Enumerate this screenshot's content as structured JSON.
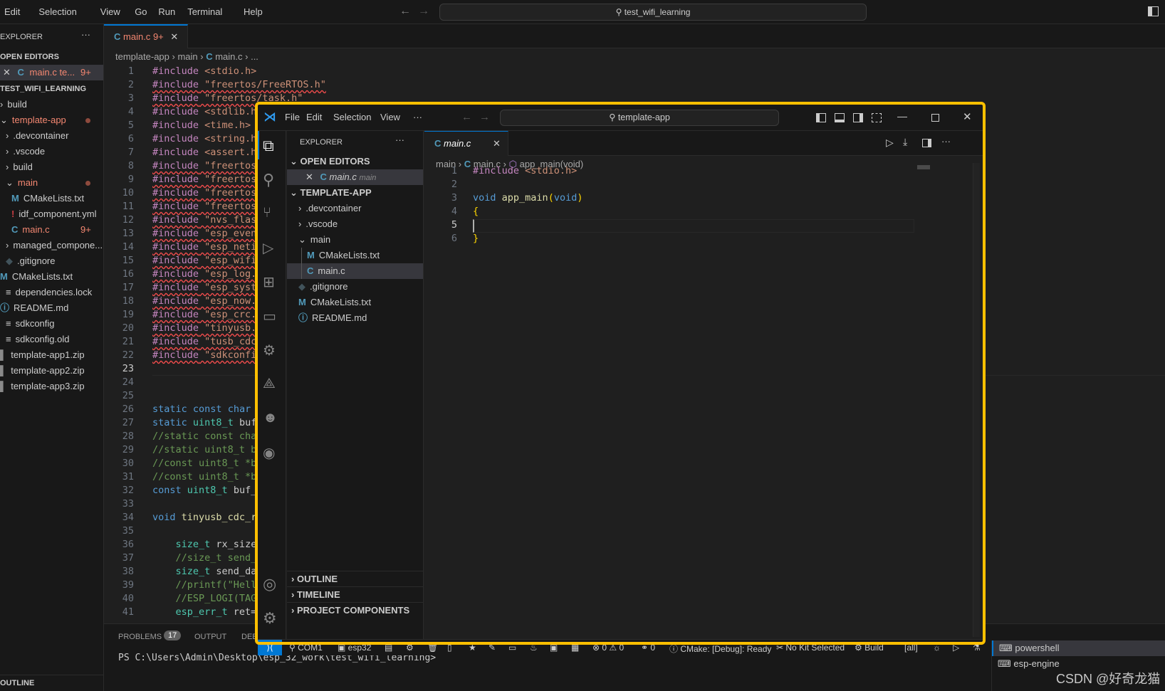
{
  "outer": {
    "menu": [
      "Edit",
      "Selection",
      "View",
      "Go",
      "Run",
      "Terminal",
      "Help"
    ],
    "search": "test_wifi_learning",
    "explorer_title": "EXPLORER",
    "more": "···",
    "open_editors_label": "OPEN EDITORS",
    "open_editor": {
      "name": "main.c te...",
      "badge": "9+"
    },
    "workspace_label": "TEST_WIFI_LEARNING",
    "tree": [
      {
        "name": "build",
        "indent": 0,
        "kind": "folder",
        "chev": ">"
      },
      {
        "name": "template-app",
        "indent": 0,
        "kind": "folder",
        "chev": "v",
        "color": "#f48771",
        "dot": true
      },
      {
        "name": ".devcontainer",
        "indent": 1,
        "kind": "folder",
        "chev": ">"
      },
      {
        "name": ".vscode",
        "indent": 1,
        "kind": "folder",
        "chev": ">"
      },
      {
        "name": "build",
        "indent": 1,
        "kind": "folder",
        "chev": ">"
      },
      {
        "name": "main",
        "indent": 1,
        "kind": "folder",
        "chev": "v",
        "color": "#f48771",
        "dot": true
      },
      {
        "name": "CMakeLists.txt",
        "indent": 2,
        "icon": "M",
        "iconColor": "#519aba"
      },
      {
        "name": "idf_component.yml",
        "indent": 2,
        "icon": "!",
        "iconColor": "#cc3e44"
      },
      {
        "name": "main.c",
        "indent": 2,
        "icon": "C",
        "iconColor": "#519aba",
        "color": "#f48771",
        "badge": "9+"
      },
      {
        "name": "managed_compone...",
        "indent": 1,
        "kind": "folder",
        "chev": ">"
      },
      {
        "name": ".gitignore",
        "indent": 1,
        "icon": "◆",
        "iconColor": "#41535b"
      },
      {
        "name": "CMakeLists.txt",
        "indent": 0,
        "icon": "M",
        "iconColor": "#519aba"
      },
      {
        "name": "dependencies.lock",
        "indent": 1,
        "icon": "≡",
        "iconColor": "#cccccc"
      },
      {
        "name": "README.md",
        "indent": 0,
        "icon": "ⓘ",
        "iconColor": "#519aba"
      },
      {
        "name": "sdkconfig",
        "indent": 1,
        "icon": "≡",
        "iconColor": "#cccccc"
      },
      {
        "name": "sdkconfig.old",
        "indent": 1,
        "icon": "≡",
        "iconColor": "#cccccc"
      },
      {
        "name": "template-app1.zip",
        "indent": 0,
        "icon": "▌",
        "iconColor": "#8a8a8a"
      },
      {
        "name": "template-app2.zip",
        "indent": 0,
        "icon": "▌",
        "iconColor": "#8a8a8a"
      },
      {
        "name": "template-app3.zip",
        "indent": 0,
        "icon": "▌",
        "iconColor": "#8a8a8a"
      }
    ],
    "outline_label": "OUTLINE",
    "tab": {
      "name": "main.c",
      "badge": "9+"
    },
    "breadcrumb": [
      "template-app",
      "main",
      "main.c",
      "..."
    ],
    "current_line": 23,
    "squiggle_lines": [
      2,
      3,
      8,
      9,
      10,
      11,
      12,
      13,
      14,
      15,
      16,
      17,
      18,
      19,
      20,
      21,
      22
    ],
    "code": [
      "#include <stdio.h>",
      "#include \"freertos/FreeRTOS.h\"",
      "#include \"freertos/task.h\"",
      "#include <stdlib.h>",
      "#include <time.h>",
      "#include <string.h>",
      "#include <assert.h>",
      "#include \"freertos/",
      "#include \"freertos/",
      "#include \"freertos/",
      "#include \"freertos/",
      "#include \"nvs_flash",
      "#include \"esp_event",
      "#include \"esp_netif",
      "#include \"esp_wifi.",
      "#include \"esp_log.h",
      "#include \"esp_syste",
      "#include \"esp_now.h",
      "#include \"esp_crc.h",
      "#include \"tinyusb.h",
      "#include \"tusb_cdc_",
      "#include \"sdkconfig",
      "",
      "",
      "",
      "static const char *",
      "static uint8_t buf[",
      "//static const char",
      "//static uint8_t bu",
      "//const uint8_t *bu",
      "//const uint8_t *bu",
      "const uint8_t buf_s",
      "",
      "void tinyusb_cdc_rx",
      "",
      "    size_t rx_size=",
      "    //size_t send_d",
      "    size_t send_dat",
      "    //printf(\"Hello",
      "    //ESP_LOGI(TAG,",
      "    esp_err_t ret=t"
    ],
    "panel_tabs": [
      "PROBLEMS",
      "OUTPUT",
      "DEE"
    ],
    "problems_count": "17",
    "terminal_prompt": "PS C:\\Users\\Admin\\Desktop\\esp_32_work\\test_wifi_learning>",
    "terminals": [
      "powershell",
      "esp-engine"
    ],
    "watermark": "CSDN @好奇龙猫"
  },
  "inner": {
    "menu": [
      "File",
      "Edit",
      "Selection",
      "View",
      "···"
    ],
    "search": "template-app",
    "explorer_title": "EXPLORER",
    "more": "···",
    "open_editors_label": "OPEN EDITORS",
    "open_editor": {
      "name": "main.c",
      "folder": "main"
    },
    "workspace_label": "TEMPLATE-APP",
    "tree": [
      {
        "name": ".devcontainer",
        "indent": 1,
        "chev": ">"
      },
      {
        "name": ".vscode",
        "indent": 1,
        "chev": ">"
      },
      {
        "name": "main",
        "indent": 1,
        "chev": "v"
      },
      {
        "name": "CMakeLists.txt",
        "indent": 2,
        "icon": "M",
        "iconColor": "#519aba"
      },
      {
        "name": "main.c",
        "indent": 2,
        "icon": "C",
        "iconColor": "#519aba",
        "selected": true
      },
      {
        "name": ".gitignore",
        "indent": 1,
        "icon": "◆",
        "iconColor": "#41535b"
      },
      {
        "name": "CMakeLists.txt",
        "indent": 1,
        "icon": "M",
        "iconColor": "#519aba"
      },
      {
        "name": "README.md",
        "indent": 1,
        "icon": "ⓘ",
        "iconColor": "#519aba"
      }
    ],
    "bottom_sections": [
      "OUTLINE",
      "TIMELINE",
      "PROJECT COMPONENTS"
    ],
    "tab": {
      "name": "main.c"
    },
    "breadcrumb": [
      "main",
      "main.c",
      "app_main(void)"
    ],
    "current_line": 5,
    "code": [
      "#include <stdio.h>",
      "",
      "void app_main(void)",
      "{",
      "",
      "}"
    ],
    "status": {
      "port": "COM1",
      "target": "esp32",
      "problems": "⊗ 0 ⚠ 0",
      "ports": "0",
      "cmake": "CMake: [Debug]: Ready",
      "kit": "No Kit Selected",
      "build": "Build",
      "target_all": "[all]"
    }
  },
  "colors": {
    "highlight_border": "#ffc000",
    "accent": "#0078d4",
    "error": "#f14c4c",
    "modified": "#f48771"
  }
}
